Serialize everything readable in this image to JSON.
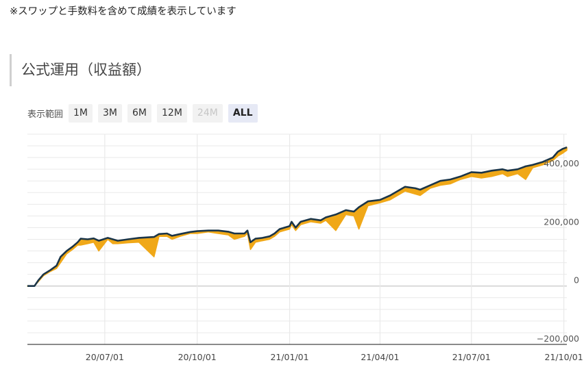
{
  "note": "※スワップと手数料を含めて成績を表示しています",
  "section_title": "公式運用（収益額）",
  "range": {
    "label": "表示範囲",
    "buttons": [
      {
        "label": "1M",
        "state": "normal"
      },
      {
        "label": "3M",
        "state": "normal"
      },
      {
        "label": "6M",
        "state": "normal"
      },
      {
        "label": "12M",
        "state": "normal"
      },
      {
        "label": "24M",
        "state": "disabled"
      },
      {
        "label": "ALL",
        "state": "active"
      }
    ]
  },
  "colors": {
    "line": "#1b3548",
    "drawdown": "#f0a818",
    "grid": "#e9e9e9",
    "zero": "#cfcfcf",
    "axis": "#444444"
  },
  "chart_data": {
    "type": "line",
    "x_start": "2020-04-15",
    "x_end": "2021-10-04",
    "ylim": [
      -200000,
      520000
    ],
    "yticks": [
      -200000,
      0,
      200000,
      400000
    ],
    "ytick_labels": [
      "−200,000",
      "0",
      "200,000",
      "400,000"
    ],
    "xticks": [
      "2020-07-01",
      "2020-10-01",
      "2021-01-01",
      "2021-04-01",
      "2021-07-01",
      "2021-10-01"
    ],
    "xtick_labels": [
      "20/07/01",
      "20/10/01",
      "21/01/01",
      "21/04/01",
      "21/07/01",
      "21/10/01"
    ],
    "series": [
      {
        "role": "equity_high",
        "points": [
          [
            "2020-04-15",
            0
          ],
          [
            "2020-04-22",
            0
          ],
          [
            "2020-04-26",
            20000
          ],
          [
            "2020-05-01",
            40000
          ],
          [
            "2020-05-08",
            55000
          ],
          [
            "2020-05-14",
            70000
          ],
          [
            "2020-05-18",
            100000
          ],
          [
            "2020-05-24",
            120000
          ],
          [
            "2020-05-30",
            135000
          ],
          [
            "2020-06-04",
            150000
          ],
          [
            "2020-06-07",
            162000
          ],
          [
            "2020-06-14",
            160000
          ],
          [
            "2020-06-20",
            163000
          ],
          [
            "2020-06-25",
            155000
          ],
          [
            "2020-07-04",
            165000
          ],
          [
            "2020-07-09",
            160000
          ],
          [
            "2020-07-14",
            155000
          ],
          [
            "2020-07-24",
            160000
          ],
          [
            "2020-08-04",
            165000
          ],
          [
            "2020-08-19",
            168000
          ],
          [
            "2020-08-24",
            178000
          ],
          [
            "2020-09-01",
            180000
          ],
          [
            "2020-09-06",
            172000
          ],
          [
            "2020-09-14",
            178000
          ],
          [
            "2020-09-24",
            185000
          ],
          [
            "2020-10-01",
            188000
          ],
          [
            "2020-10-12",
            190000
          ],
          [
            "2020-10-22",
            190000
          ],
          [
            "2020-11-01",
            186000
          ],
          [
            "2020-11-07",
            180000
          ],
          [
            "2020-11-17",
            180000
          ],
          [
            "2020-11-20",
            190000
          ],
          [
            "2020-11-23",
            150000
          ],
          [
            "2020-11-28",
            162000
          ],
          [
            "2020-12-05",
            165000
          ],
          [
            "2020-12-12",
            170000
          ],
          [
            "2020-12-17",
            180000
          ],
          [
            "2020-12-22",
            195000
          ],
          [
            "2020-12-27",
            200000
          ],
          [
            "2021-01-01",
            205000
          ],
          [
            "2021-01-03",
            220000
          ],
          [
            "2021-01-07",
            200000
          ],
          [
            "2021-01-12",
            220000
          ],
          [
            "2021-01-22",
            230000
          ],
          [
            "2021-02-01",
            225000
          ],
          [
            "2021-02-06",
            235000
          ],
          [
            "2021-02-16",
            245000
          ],
          [
            "2021-02-26",
            260000
          ],
          [
            "2021-03-06",
            255000
          ],
          [
            "2021-03-11",
            270000
          ],
          [
            "2021-03-20",
            290000
          ],
          [
            "2021-04-01",
            295000
          ],
          [
            "2021-04-11",
            310000
          ],
          [
            "2021-04-21",
            330000
          ],
          [
            "2021-04-26",
            340000
          ],
          [
            "2021-05-06",
            335000
          ],
          [
            "2021-05-11",
            330000
          ],
          [
            "2021-05-21",
            345000
          ],
          [
            "2021-05-31",
            360000
          ],
          [
            "2021-06-10",
            365000
          ],
          [
            "2021-06-20",
            375000
          ],
          [
            "2021-07-01",
            390000
          ],
          [
            "2021-07-11",
            388000
          ],
          [
            "2021-07-21",
            395000
          ],
          [
            "2021-08-01",
            400000
          ],
          [
            "2021-08-06",
            395000
          ],
          [
            "2021-08-16",
            400000
          ],
          [
            "2021-08-24",
            410000
          ],
          [
            "2021-08-31",
            415000
          ],
          [
            "2021-09-10",
            425000
          ],
          [
            "2021-09-20",
            440000
          ],
          [
            "2021-09-25",
            460000
          ],
          [
            "2021-09-30",
            470000
          ],
          [
            "2021-10-04",
            475000
          ]
        ]
      },
      {
        "role": "drawdown_low",
        "points": [
          [
            "2020-04-15",
            0
          ],
          [
            "2020-04-22",
            0
          ],
          [
            "2020-04-26",
            15000
          ],
          [
            "2020-05-01",
            35000
          ],
          [
            "2020-05-08",
            50000
          ],
          [
            "2020-05-14",
            60000
          ],
          [
            "2020-05-18",
            80000
          ],
          [
            "2020-05-24",
            110000
          ],
          [
            "2020-05-30",
            125000
          ],
          [
            "2020-06-04",
            140000
          ],
          [
            "2020-06-07",
            140000
          ],
          [
            "2020-06-14",
            145000
          ],
          [
            "2020-06-20",
            150000
          ],
          [
            "2020-06-25",
            120000
          ],
          [
            "2020-07-04",
            160000
          ],
          [
            "2020-07-09",
            145000
          ],
          [
            "2020-07-14",
            145000
          ],
          [
            "2020-07-24",
            148000
          ],
          [
            "2020-08-04",
            150000
          ],
          [
            "2020-08-19",
            100000
          ],
          [
            "2020-08-24",
            170000
          ],
          [
            "2020-09-01",
            170000
          ],
          [
            "2020-09-06",
            160000
          ],
          [
            "2020-09-14",
            170000
          ],
          [
            "2020-09-24",
            180000
          ],
          [
            "2020-10-01",
            180000
          ],
          [
            "2020-10-12",
            185000
          ],
          [
            "2020-10-22",
            180000
          ],
          [
            "2020-11-01",
            175000
          ],
          [
            "2020-11-07",
            160000
          ],
          [
            "2020-11-17",
            170000
          ],
          [
            "2020-11-20",
            180000
          ],
          [
            "2020-11-23",
            125000
          ],
          [
            "2020-11-28",
            150000
          ],
          [
            "2020-12-05",
            155000
          ],
          [
            "2020-12-12",
            160000
          ],
          [
            "2020-12-17",
            170000
          ],
          [
            "2020-12-22",
            185000
          ],
          [
            "2020-12-27",
            190000
          ],
          [
            "2021-01-01",
            195000
          ],
          [
            "2021-01-03",
            210000
          ],
          [
            "2021-01-07",
            190000
          ],
          [
            "2021-01-12",
            210000
          ],
          [
            "2021-01-22",
            220000
          ],
          [
            "2021-02-01",
            215000
          ],
          [
            "2021-02-06",
            225000
          ],
          [
            "2021-02-16",
            190000
          ],
          [
            "2021-02-26",
            245000
          ],
          [
            "2021-03-06",
            240000
          ],
          [
            "2021-03-11",
            195000
          ],
          [
            "2021-03-20",
            275000
          ],
          [
            "2021-04-01",
            285000
          ],
          [
            "2021-04-11",
            295000
          ],
          [
            "2021-04-21",
            315000
          ],
          [
            "2021-04-26",
            325000
          ],
          [
            "2021-05-06",
            315000
          ],
          [
            "2021-05-11",
            310000
          ],
          [
            "2021-05-21",
            335000
          ],
          [
            "2021-05-31",
            345000
          ],
          [
            "2021-06-10",
            350000
          ],
          [
            "2021-06-20",
            365000
          ],
          [
            "2021-07-01",
            375000
          ],
          [
            "2021-07-11",
            370000
          ],
          [
            "2021-07-21",
            375000
          ],
          [
            "2021-08-01",
            385000
          ],
          [
            "2021-08-06",
            375000
          ],
          [
            "2021-08-16",
            385000
          ],
          [
            "2021-08-24",
            365000
          ],
          [
            "2021-08-31",
            405000
          ],
          [
            "2021-09-10",
            415000
          ],
          [
            "2021-09-20",
            430000
          ],
          [
            "2021-09-25",
            445000
          ],
          [
            "2021-09-30",
            455000
          ],
          [
            "2021-10-04",
            465000
          ]
        ]
      }
    ]
  }
}
